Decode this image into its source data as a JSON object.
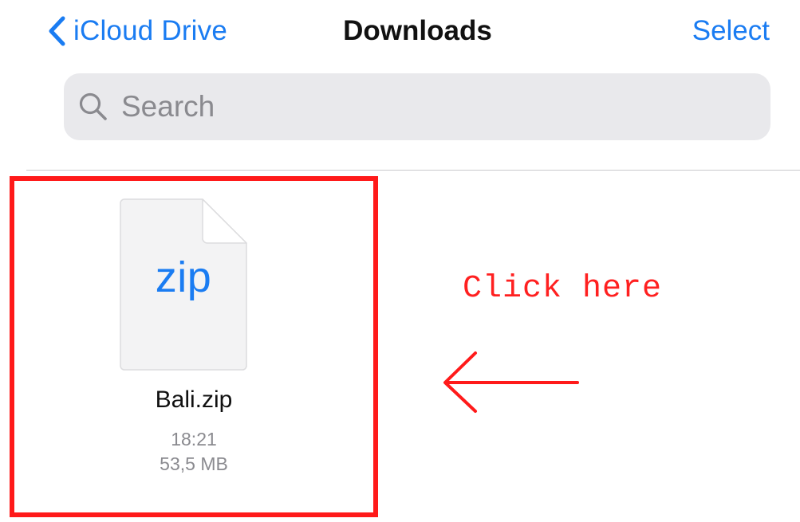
{
  "nav": {
    "back_label": "iCloud Drive",
    "title": "Downloads",
    "select_label": "Select"
  },
  "search": {
    "placeholder": "Search"
  },
  "files": [
    {
      "name": "Bali.zip",
      "icon_label": "zip",
      "time": "18:21",
      "size": "53,5 MB"
    }
  ],
  "annotation": {
    "text": "Click here",
    "color": "#ff1a1a"
  },
  "colors": {
    "accent": "#1a7cf2",
    "search_bg": "#e9e9ec",
    "secondary_text": "#8a8a8f"
  },
  "icons": {
    "back": "chevron-left-icon",
    "search": "magnifier-icon",
    "file": "zip-file-icon",
    "annotation_arrow": "arrow-left-icon"
  }
}
